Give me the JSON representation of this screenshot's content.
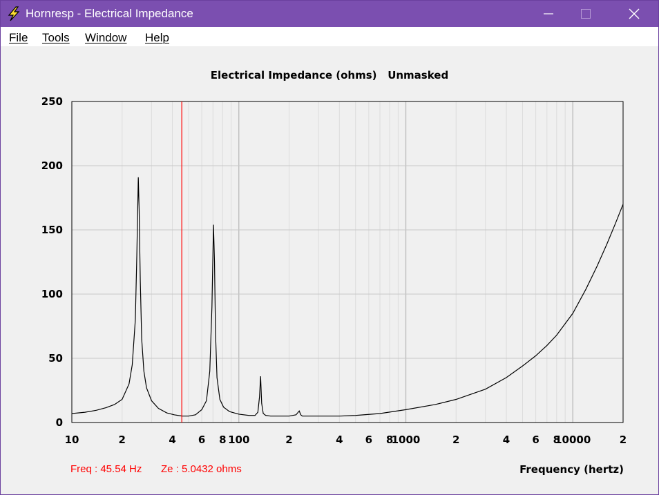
{
  "window": {
    "title": "Hornresp - Electrical Impedance",
    "icon": "lightning-bolt-icon",
    "controls": [
      "minimize-icon",
      "maximize-icon",
      "close-icon"
    ]
  },
  "menu": {
    "items": [
      {
        "label": "File"
      },
      {
        "label": "Tools"
      },
      {
        "label": "Window"
      },
      {
        "label": "Help"
      }
    ]
  },
  "readout": {
    "freq": "Freq : 45.54 Hz",
    "ze": "Ze : 5.0432 ohms"
  },
  "colors": {
    "titlebar": "#7b4fb0",
    "trace": "#000000",
    "cursor": "#ff0000",
    "grid": "#c8c8c8"
  },
  "chart_data": {
    "type": "line",
    "title": "Electrical Impedance (ohms)   Unmasked",
    "xlabel": "Frequency (hertz)",
    "ylabel": "",
    "x_scale": "log",
    "xlim": [
      10,
      20000
    ],
    "ylim": [
      0,
      250
    ],
    "grid": true,
    "y_ticks": [
      0,
      50,
      100,
      150,
      200,
      250
    ],
    "x_tick_labels": [
      {
        "value": 10,
        "label": "10"
      },
      {
        "value": 20,
        "label": "2"
      },
      {
        "value": 40,
        "label": "4"
      },
      {
        "value": 60,
        "label": "6"
      },
      {
        "value": 80,
        "label": "8"
      },
      {
        "value": 100,
        "label": "100"
      },
      {
        "value": 200,
        "label": "2"
      },
      {
        "value": 400,
        "label": "4"
      },
      {
        "value": 600,
        "label": "6"
      },
      {
        "value": 800,
        "label": "8"
      },
      {
        "value": 1000,
        "label": "1000"
      },
      {
        "value": 2000,
        "label": "2"
      },
      {
        "value": 4000,
        "label": "4"
      },
      {
        "value": 6000,
        "label": "6"
      },
      {
        "value": 8000,
        "label": "8"
      },
      {
        "value": 10000,
        "label": "10000"
      },
      {
        "value": 20000,
        "label": "2"
      }
    ],
    "cursor_x": 45.54,
    "series": [
      {
        "x": [
          10,
          12,
          14,
          16,
          18,
          20,
          22,
          23,
          24,
          24.5,
          25,
          25.3,
          25.7,
          26.2,
          27,
          28,
          30,
          33,
          37,
          41,
          45.54,
          50,
          55,
          60,
          64,
          67,
          69,
          70.5,
          71.5,
          72.5,
          74,
          77,
          81,
          88,
          100,
          115,
          125,
          130,
          133,
          135,
          137,
          140,
          145,
          155,
          170,
          200,
          220,
          230,
          235,
          240,
          260,
          300,
          400,
          500,
          700,
          1000,
          1500,
          2000,
          3000,
          4000,
          5000,
          6000,
          7000,
          8000,
          10000,
          12000,
          14000,
          16000,
          18000,
          20000
        ],
        "y": [
          7,
          8,
          9.5,
          11.5,
          14,
          18,
          30,
          45,
          80,
          130,
          191,
          165,
          110,
          65,
          40,
          27,
          17,
          11,
          7.5,
          6,
          5.04,
          5,
          6,
          10,
          17,
          40,
          90,
          154,
          125,
          70,
          35,
          18,
          12,
          8.5,
          6.5,
          5.5,
          5.5,
          8,
          20,
          36,
          15,
          7,
          5.5,
          5,
          5,
          5,
          6,
          9,
          6,
          5,
          5,
          5,
          5,
          5.5,
          7,
          10,
          14,
          18,
          26,
          35,
          44,
          52,
          60,
          68,
          85,
          104,
          122,
          139,
          155,
          170
        ]
      }
    ]
  }
}
